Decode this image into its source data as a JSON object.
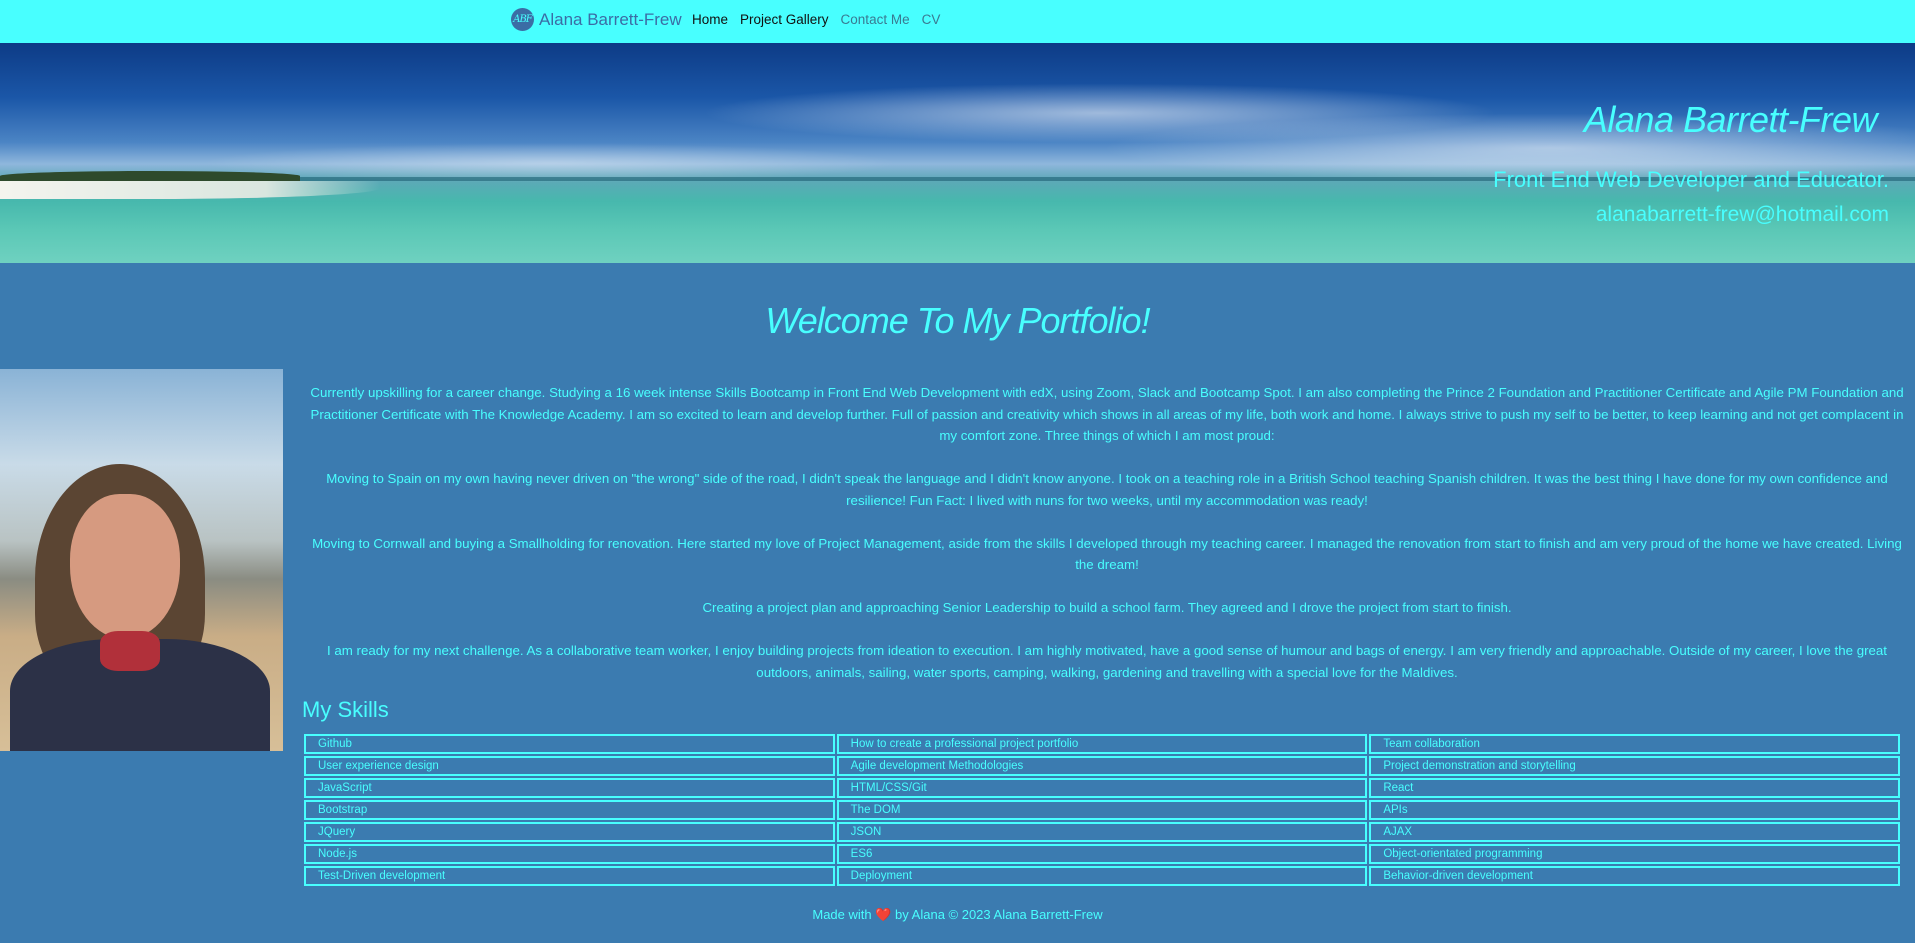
{
  "nav": {
    "brand_initials": "ABF",
    "brand": "Alana Barrett-Frew",
    "links": [
      "Home",
      "Project Gallery",
      "Contact Me",
      "CV"
    ]
  },
  "hero": {
    "name": "Alana Barrett-Frew",
    "role": "Front End Web Developer and Educator.",
    "email": "alanabarrett-frew@hotmail.com"
  },
  "main": {
    "welcome": "Welcome To My Portfolio!",
    "bio": [
      "Currently upskilling for a career change. Studying a 16 week intense Skills Bootcamp in Front End Web Development with edX, using Zoom, Slack and Bootcamp Spot. I am also completing the Prince 2 Foundation and Practitioner Certificate and Agile PM Foundation and Practitioner Certificate with The Knowledge Academy. I am so excited to learn and develop further. Full of passion and creativity which shows in all areas of my life, both work and home. I always strive to push my self to be better, to keep learning and not get complacent in my comfort zone. Three things of which I am most proud:",
      "Moving to Spain on my own having never driven on \"the wrong\" side of the road, I didn't speak the language and I didn't know anyone. I took on a teaching role in a British School teaching Spanish children. It was the best thing I have done for my own confidence and resilience! Fun Fact: I lived with nuns for two weeks, until my accommodation was ready!",
      "Moving to Cornwall and buying a Smallholding for renovation. Here started my love of Project Management, aside from the skills I developed through my teaching career. I managed the renovation from start to finish and am very proud of the home we have created. Living the dream!",
      "Creating a project plan and approaching Senior Leadership to build a school farm. They agreed and I drove the project from start to finish.",
      "I am ready for my next challenge. As a collaborative team worker, I enjoy building projects from ideation to execution. I am highly motivated, have a good sense of humour and bags of energy. I am very friendly and approachable. Outside of my career, I love the great outdoors, animals, sailing, water sports, camping, walking, gardening and travelling with a special love for the Maldives."
    ],
    "skills_title": "My Skills",
    "skills": [
      [
        "Github",
        "How to create a professional project portfolio",
        "Team collaboration"
      ],
      [
        "User experience design",
        "Agile development Methodologies",
        "Project demonstration and storytelling"
      ],
      [
        "JavaScript",
        "HTML/CSS/Git",
        "React"
      ],
      [
        "Bootstrap",
        "The DOM",
        "APIs"
      ],
      [
        "JQuery",
        "JSON",
        "AJAX"
      ],
      [
        "Node.js",
        "ES6",
        "Object-orientated programming"
      ],
      [
        "Test-Driven development",
        "Deployment",
        "Behavior-driven development"
      ]
    ]
  },
  "footer": {
    "before": "Made with",
    "heart": "❤️",
    "after": "by Alana © 2023 Alana Barrett-Frew"
  },
  "colors": {
    "navbar": "#48ffff",
    "page_bg": "#3b7bb0",
    "text_accent": "#48ffff"
  }
}
